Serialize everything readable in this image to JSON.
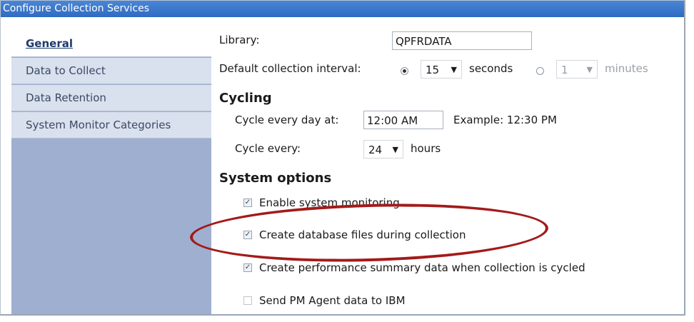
{
  "window": {
    "title": "Configure Collection Services"
  },
  "sidebar": {
    "items": [
      {
        "label": "General",
        "active": true
      },
      {
        "label": "Data to Collect",
        "active": false
      },
      {
        "label": "Data Retention",
        "active": false
      },
      {
        "label": "System Monitor Categories",
        "active": false
      }
    ]
  },
  "form": {
    "library_label": "Library:",
    "library_value": "QPFRDATA",
    "interval_label": "Default collection interval:",
    "interval_seconds_value": "15",
    "seconds_label": "seconds",
    "interval_minutes_value": "1",
    "minutes_label": "minutes",
    "selected_interval_unit": "seconds"
  },
  "cycling": {
    "heading": "Cycling",
    "cycle_day_label": "Cycle every day at:",
    "cycle_day_value": "12:00 AM",
    "example_text": "Example: 12:30 PM",
    "cycle_every_label": "Cycle every:",
    "cycle_every_value": "24",
    "hours_label": "hours"
  },
  "system_options": {
    "heading": "System options",
    "options": [
      {
        "label": "Enable system monitoring",
        "checked": true
      },
      {
        "label": "Create database files during collection",
        "checked": true
      },
      {
        "label": "Create performance summary data when collection is cycled",
        "checked": true
      },
      {
        "label": "Send PM Agent data to IBM",
        "checked": false
      }
    ]
  },
  "annotation": {
    "highlight_color": "#a31a1a"
  }
}
